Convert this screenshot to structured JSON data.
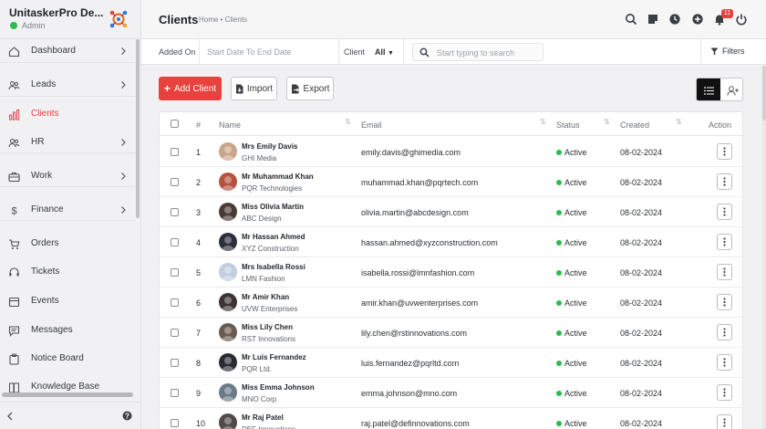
{
  "brand": {
    "name": "UnitaskerPro De...",
    "role": "Admin"
  },
  "sidebar": {
    "items": [
      {
        "label": "Dashboard",
        "icon": "home-icon",
        "arrow": true,
        "active": false
      },
      {
        "label": "Leads",
        "icon": "leads-icon",
        "arrow": true,
        "active": false
      },
      {
        "label": "Clients",
        "icon": "bar-chart-icon",
        "arrow": false,
        "active": true
      },
      {
        "label": "HR",
        "icon": "people-icon",
        "arrow": true,
        "active": false
      },
      {
        "label": "Work",
        "icon": "briefcase-icon",
        "arrow": true,
        "active": false
      },
      {
        "label": "Finance",
        "icon": "dollar-icon",
        "arrow": true,
        "active": false
      },
      {
        "label": "Orders",
        "icon": "cart-icon",
        "arrow": false,
        "active": false
      },
      {
        "label": "Tickets",
        "icon": "headset-icon",
        "arrow": false,
        "active": false
      },
      {
        "label": "Events",
        "icon": "calendar-icon",
        "arrow": false,
        "active": false
      },
      {
        "label": "Messages",
        "icon": "message-icon",
        "arrow": false,
        "active": false
      },
      {
        "label": "Notice Board",
        "icon": "clipboard-icon",
        "arrow": false,
        "active": false
      },
      {
        "label": "Knowledge Base",
        "icon": "book-icon",
        "arrow": false,
        "active": false
      }
    ]
  },
  "header": {
    "title": "Clients",
    "breadcrumb": "Home • Clients",
    "notification_count": "11"
  },
  "filters": {
    "added_on_label": "Added On",
    "date_placeholder": "Start Date To End Date",
    "client_label": "Client",
    "client_value": "All",
    "search_placeholder": "Start typing to search",
    "filters_label": "Filters"
  },
  "toolbar": {
    "add_label": "Add Client",
    "import_label": "Import",
    "export_label": "Export"
  },
  "table": {
    "columns": {
      "index": "#",
      "name": "Name",
      "email": "Email",
      "status": "Status",
      "created": "Created",
      "action": "Action"
    },
    "rows": [
      {
        "no": "1",
        "name": "Mrs Emily Davis",
        "company": "GHI Media",
        "email": "emily.davis@ghimedia.com",
        "status": "Active",
        "created": "08-02-2024",
        "avatar_color": "#c9a58b"
      },
      {
        "no": "2",
        "name": "Mr Muhammad Khan",
        "company": "PQR Technologies",
        "email": "muhammad.khan@pqrtech.com",
        "status": "Active",
        "created": "08-02-2024",
        "avatar_color": "#b4513f"
      },
      {
        "no": "3",
        "name": "Miss Olivia Martin",
        "company": "ABC Design",
        "email": "olivia.martin@abcdesign.com",
        "status": "Active",
        "created": "08-02-2024",
        "avatar_color": "#4a3a33"
      },
      {
        "no": "4",
        "name": "Mr Hassan Ahmed",
        "company": "XYZ Construction",
        "email": "hassan.ahmed@xyzconstruction.com",
        "status": "Active",
        "created": "08-02-2024",
        "avatar_color": "#2b2f3a"
      },
      {
        "no": "5",
        "name": "Mrs Isabella Rossi",
        "company": "LMN Fashion",
        "email": "isabella.rossi@lmnfashion.com",
        "status": "Active",
        "created": "08-02-2024",
        "avatar_color": "#c2cde0"
      },
      {
        "no": "6",
        "name": "Mr Amir Khan",
        "company": "UVW Enterprises",
        "email": "amir.khan@uvwenterprises.com",
        "status": "Active",
        "created": "08-02-2024",
        "avatar_color": "#3b3433"
      },
      {
        "no": "7",
        "name": "Miss Lily Chen",
        "company": "RST Innovations",
        "email": "lily.chen@rstinnovations.com",
        "status": "Active",
        "created": "08-02-2024",
        "avatar_color": "#6b5a4e"
      },
      {
        "no": "8",
        "name": "Mr Luis Fernandez",
        "company": "PQR Ltd.",
        "email": "luis.fernandez@pqrltd.com",
        "status": "Active",
        "created": "08-02-2024",
        "avatar_color": "#2a2c33"
      },
      {
        "no": "9",
        "name": "Miss Emma Johnson",
        "company": "MNO Corp",
        "email": "emma.johnson@mno.com",
        "status": "Active",
        "created": "08-02-2024",
        "avatar_color": "#6c7a88"
      },
      {
        "no": "10",
        "name": "Mr Raj Patel",
        "company": "DEF Innovations",
        "email": "raj.patel@definnovations.com",
        "status": "Active",
        "created": "08-02-2024",
        "avatar_color": "#514a48"
      }
    ]
  },
  "colors": {
    "accent": "#e8423f",
    "active_status": "#2dbb4e"
  }
}
